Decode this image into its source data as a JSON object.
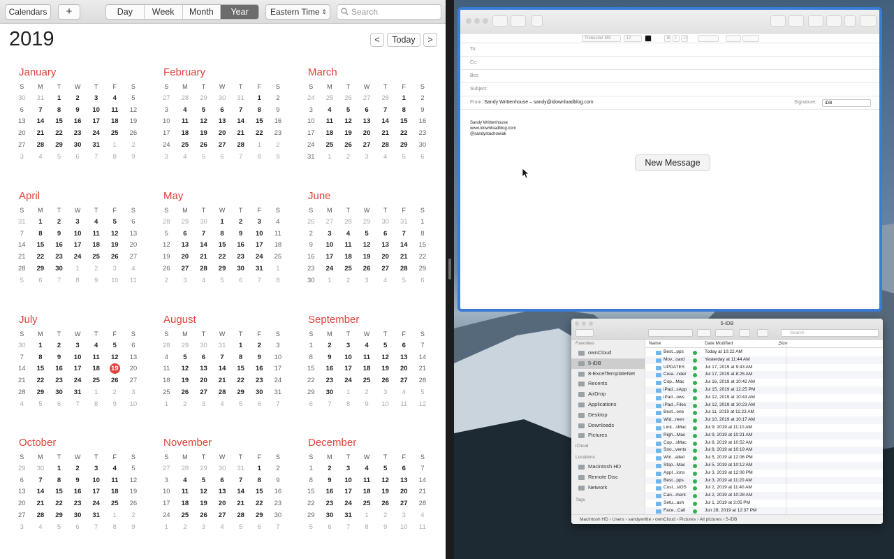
{
  "calendar": {
    "toolbar": {
      "calendars": "Calendars",
      "add": "+",
      "views": [
        "Day",
        "Week",
        "Month",
        "Year"
      ],
      "active_view": "Year",
      "timezone": "Eastern Time",
      "search_placeholder": "Search"
    },
    "year": "2019",
    "nav": {
      "prev": "<",
      "today": "Today",
      "next": ">"
    },
    "day_headers": [
      "S",
      "M",
      "T",
      "W",
      "T",
      "F",
      "S"
    ],
    "accent": "#e0413a",
    "today": {
      "month": 6,
      "day": 19
    },
    "months": [
      {
        "name": "January",
        "days": [
          "30",
          "31",
          "1",
          "2",
          "3",
          "4",
          "5",
          "6",
          "7",
          "8",
          "9",
          "10",
          "11",
          "12",
          "13",
          "14",
          "15",
          "16",
          "17",
          "18",
          "19",
          "20",
          "21",
          "22",
          "23",
          "24",
          "25",
          "26",
          "27",
          "28",
          "29",
          "30",
          "31",
          "1",
          "2",
          "3",
          "4",
          "5",
          "6",
          "7",
          "8",
          "9"
        ],
        "first": 2,
        "count": 31
      },
      {
        "name": "February",
        "days": [
          "27",
          "28",
          "29",
          "30",
          "31",
          "1",
          "2",
          "3",
          "4",
          "5",
          "6",
          "7",
          "8",
          "9",
          "10",
          "11",
          "12",
          "13",
          "14",
          "15",
          "16",
          "17",
          "18",
          "19",
          "20",
          "21",
          "22",
          "23",
          "24",
          "25",
          "26",
          "27",
          "28",
          "1",
          "2",
          "3",
          "4",
          "5",
          "6",
          "7",
          "8",
          "9"
        ],
        "first": 5,
        "count": 28
      },
      {
        "name": "March",
        "days": [
          "24",
          "25",
          "26",
          "27",
          "28",
          "1",
          "2",
          "3",
          "4",
          "5",
          "6",
          "7",
          "8",
          "9",
          "10",
          "11",
          "12",
          "13",
          "14",
          "15",
          "16",
          "17",
          "18",
          "19",
          "20",
          "21",
          "22",
          "23",
          "24",
          "25",
          "26",
          "27",
          "28",
          "29",
          "30",
          "31",
          "1",
          "2",
          "3",
          "4",
          "5",
          "6"
        ],
        "first": 5,
        "count": 31
      },
      {
        "name": "April",
        "days": [
          "31",
          "1",
          "2",
          "3",
          "4",
          "5",
          "6",
          "7",
          "8",
          "9",
          "10",
          "11",
          "12",
          "13",
          "14",
          "15",
          "16",
          "17",
          "18",
          "19",
          "20",
          "21",
          "22",
          "23",
          "24",
          "25",
          "26",
          "27",
          "28",
          "29",
          "30",
          "1",
          "2",
          "3",
          "4",
          "5",
          "6",
          "7",
          "8",
          "9",
          "10",
          "11"
        ],
        "first": 1,
        "count": 30
      },
      {
        "name": "May",
        "days": [
          "28",
          "29",
          "30",
          "1",
          "2",
          "3",
          "4",
          "5",
          "6",
          "7",
          "8",
          "9",
          "10",
          "11",
          "12",
          "13",
          "14",
          "15",
          "16",
          "17",
          "18",
          "19",
          "20",
          "21",
          "22",
          "23",
          "24",
          "25",
          "26",
          "27",
          "28",
          "29",
          "30",
          "31",
          "1",
          "2",
          "3",
          "4",
          "5",
          "6",
          "7",
          "8"
        ],
        "first": 3,
        "count": 31
      },
      {
        "name": "June",
        "days": [
          "26",
          "27",
          "28",
          "29",
          "30",
          "31",
          "1",
          "2",
          "3",
          "4",
          "5",
          "6",
          "7",
          "8",
          "9",
          "10",
          "11",
          "12",
          "13",
          "14",
          "15",
          "16",
          "17",
          "18",
          "19",
          "20",
          "21",
          "22",
          "23",
          "24",
          "25",
          "26",
          "27",
          "28",
          "29",
          "30",
          "1",
          "2",
          "3",
          "4",
          "5",
          "6"
        ],
        "first": 6,
        "count": 30
      },
      {
        "name": "July",
        "days": [
          "30",
          "1",
          "2",
          "3",
          "4",
          "5",
          "6",
          "7",
          "8",
          "9",
          "10",
          "11",
          "12",
          "13",
          "14",
          "15",
          "16",
          "17",
          "18",
          "19",
          "20",
          "21",
          "22",
          "23",
          "24",
          "25",
          "26",
          "27",
          "28",
          "29",
          "30",
          "31",
          "1",
          "2",
          "3",
          "4",
          "5",
          "6",
          "7",
          "8",
          "9",
          "10"
        ],
        "first": 1,
        "count": 31
      },
      {
        "name": "August",
        "days": [
          "28",
          "29",
          "30",
          "31",
          "1",
          "2",
          "3",
          "4",
          "5",
          "6",
          "7",
          "8",
          "9",
          "10",
          "11",
          "12",
          "13",
          "14",
          "15",
          "16",
          "17",
          "18",
          "19",
          "20",
          "21",
          "22",
          "23",
          "24",
          "25",
          "26",
          "27",
          "28",
          "29",
          "30",
          "31",
          "1",
          "2",
          "3",
          "4",
          "5",
          "6",
          "7"
        ],
        "first": 4,
        "count": 31
      },
      {
        "name": "September",
        "days": [
          "1",
          "2",
          "3",
          "4",
          "5",
          "6",
          "7",
          "8",
          "9",
          "10",
          "11",
          "12",
          "13",
          "14",
          "15",
          "16",
          "17",
          "18",
          "19",
          "20",
          "21",
          "22",
          "23",
          "24",
          "25",
          "26",
          "27",
          "28",
          "29",
          "30",
          "1",
          "2",
          "3",
          "4",
          "5",
          "6",
          "7",
          "8",
          "9",
          "10",
          "11",
          "12"
        ],
        "first": 0,
        "count": 30
      },
      {
        "name": "October",
        "days": [
          "29",
          "30",
          "1",
          "2",
          "3",
          "4",
          "5",
          "6",
          "7",
          "8",
          "9",
          "10",
          "11",
          "12",
          "13",
          "14",
          "15",
          "16",
          "17",
          "18",
          "19",
          "20",
          "21",
          "22",
          "23",
          "24",
          "25",
          "26",
          "27",
          "28",
          "29",
          "30",
          "31",
          "1",
          "2",
          "3",
          "4",
          "5",
          "6",
          "7",
          "8",
          "9"
        ],
        "first": 2,
        "count": 31
      },
      {
        "name": "November",
        "days": [
          "27",
          "28",
          "29",
          "30",
          "31",
          "1",
          "2",
          "3",
          "4",
          "5",
          "6",
          "7",
          "8",
          "9",
          "10",
          "11",
          "12",
          "13",
          "14",
          "15",
          "16",
          "17",
          "18",
          "19",
          "20",
          "21",
          "22",
          "23",
          "24",
          "25",
          "26",
          "27",
          "28",
          "29",
          "30",
          "1",
          "2",
          "3",
          "4",
          "5",
          "6",
          "7"
        ],
        "first": 5,
        "count": 30
      },
      {
        "name": "December",
        "days": [
          "1",
          "2",
          "3",
          "4",
          "5",
          "6",
          "7",
          "8",
          "9",
          "10",
          "11",
          "12",
          "13",
          "14",
          "15",
          "16",
          "17",
          "18",
          "19",
          "20",
          "21",
          "22",
          "23",
          "24",
          "25",
          "26",
          "27",
          "28",
          "29",
          "30",
          "31",
          "1",
          "2",
          "3",
          "4",
          "5",
          "6",
          "7",
          "8",
          "9",
          "10",
          "11"
        ],
        "first": 0,
        "count": 31
      }
    ]
  },
  "mail": {
    "font": "Trebuchet MS",
    "size": "12",
    "to_label": "To:",
    "cc_label": "Cc:",
    "bcc_label": "Bcc:",
    "subject_label": "Subject:",
    "from_label": "From:",
    "from_value": "Sandy Writtenhouse – sandy@idownloadblog.com",
    "signature_label": "Signature:",
    "signature_value": "iDB",
    "signature_lines": [
      "Sandy Writtenhouse",
      "www.idownloadblog.com",
      "@sandystachowiak"
    ],
    "button": "New Message"
  },
  "finder": {
    "title": "5-iDB",
    "search_placeholder": "Search",
    "sidebar": {
      "favorites_header": "Favorites",
      "favorites": [
        "ownCloud",
        "5-iDB",
        "8-ExcelTemplateNet",
        "Recents",
        "AirDrop",
        "Applications",
        "Desktop",
        "Downloads",
        "Pictures"
      ],
      "selected": "5-iDB",
      "icloud_header": "iCloud",
      "locations_header": "Locations",
      "locations": [
        "Macintosh HD",
        "Remote Disc",
        "Network"
      ],
      "tags_header": "Tags"
    },
    "columns": {
      "name": "Name",
      "date": "Date Modified",
      "size": "Size"
    },
    "files": [
      {
        "name": "Best...pps",
        "date": "Today at 10:22 AM"
      },
      {
        "name": "Mov...oard",
        "date": "Yesterday at 11:44 AM"
      },
      {
        "name": "UPDATES",
        "date": "Jul 17, 2019 at 9:43 AM"
      },
      {
        "name": "Crea...nder",
        "date": "Jul 17, 2019 at 8:25 AM"
      },
      {
        "name": "Cop...Mac",
        "date": "Jul 16, 2019 at 10:42 AM"
      },
      {
        "name": "iPad...sApp",
        "date": "Jul 15, 2019 at 12:25 PM"
      },
      {
        "name": "iPad...ows",
        "date": "Jul 12, 2019 at 10:43 AM"
      },
      {
        "name": "iPad...Files",
        "date": "Jul 12, 2019 at 10:23 AM"
      },
      {
        "name": "Best...one",
        "date": "Jul 11, 2019 at 11:23 AM"
      },
      {
        "name": "Wid...reen",
        "date": "Jul 10, 2019 at 10:17 AM"
      },
      {
        "name": "Link...sMac",
        "date": "Jul 9, 2019 at 11:10 AM"
      },
      {
        "name": "Righ...Mac",
        "date": "Jul 9, 2019 at 10:21 AM"
      },
      {
        "name": "Cop...sMac",
        "date": "Jul 8, 2019 at 10:52 AM"
      },
      {
        "name": "Sno...vents",
        "date": "Jul 8, 2019 at 10:19 AM"
      },
      {
        "name": "Win...alled",
        "date": "Jul 5, 2019 at 12:06 PM"
      },
      {
        "name": "Stop...Mac",
        "date": "Jul 5, 2019 at 10:12 AM"
      },
      {
        "name": "Appl...ions",
        "date": "Jul 3, 2019 at 12:08 PM"
      },
      {
        "name": "Best...pps",
        "date": "Jul 3, 2019 at 11:20 AM"
      },
      {
        "name": "Cust...siOS",
        "date": "Jul 2, 2019 at 11:40 AM"
      },
      {
        "name": "Can...ment",
        "date": "Jul 2, 2019 at 10:28 AM"
      },
      {
        "name": "Setu...ash",
        "date": "Jul 1, 2019 at 3:05 PM"
      },
      {
        "name": "Face...Call",
        "date": "Jun 28, 2019 at 12:37 PM"
      }
    ],
    "path": [
      "Macintosh HD",
      "Users",
      "sandywritte",
      "ownCloud",
      "Pictures",
      "All pictures",
      "5-iDB"
    ]
  }
}
